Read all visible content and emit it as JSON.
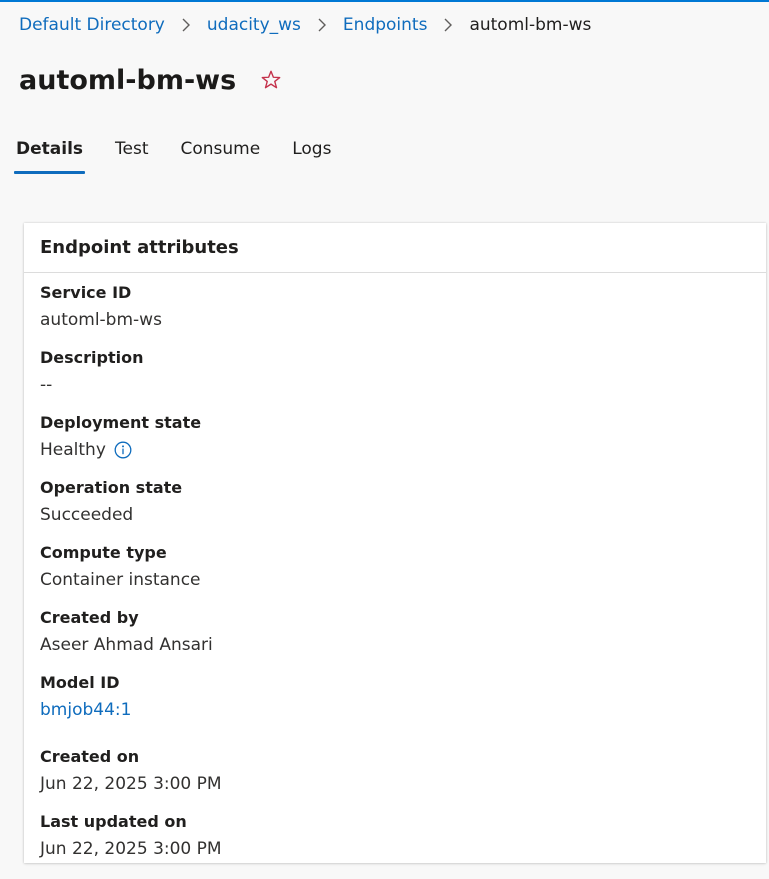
{
  "breadcrumb": {
    "items": [
      "Default Directory",
      "udacity_ws",
      "Endpoints"
    ],
    "current": "automl-bm-ws"
  },
  "title": "automl-bm-ws",
  "icons": {
    "favorite": "star-outline-icon",
    "separator": "chevron-right-icon",
    "info": "info-circle-icon"
  },
  "tabs": [
    "Details",
    "Test",
    "Consume",
    "Logs"
  ],
  "active_tab": "Details",
  "card": {
    "title": "Endpoint attributes",
    "attributes": [
      {
        "label": "Service ID",
        "value": "automl-bm-ws"
      },
      {
        "label": "Description",
        "value": "--"
      },
      {
        "label": "Deployment state",
        "value": "Healthy"
      },
      {
        "label": "Operation state",
        "value": "Succeeded"
      },
      {
        "label": "Compute type",
        "value": "Container instance"
      },
      {
        "label": "Created by",
        "value": "Aseer Ahmad Ansari"
      },
      {
        "label": "Model ID",
        "value": "bmjob44:1"
      },
      {
        "label": "Created on",
        "value": "Jun 22, 2025 3:00 PM"
      },
      {
        "label": "Last updated on",
        "value": "Jun 22, 2025 3:00 PM"
      }
    ]
  },
  "colors": {
    "link": "#0f6cbd",
    "accent": "#0078d4",
    "star": "#c4314b",
    "background": "#f8f8f8"
  }
}
